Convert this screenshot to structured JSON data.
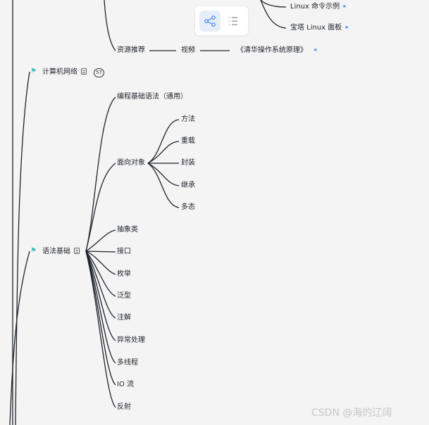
{
  "toggle": {
    "mindmap_icon": "mindmap-icon",
    "outline_icon": "outline-list-icon"
  },
  "nodes": {
    "linux_cmd": "Linux 命令示例",
    "baota": "宝塔 Linux 面板",
    "resources": "资源推荐",
    "video": "视频",
    "tsinghua": "《清华操作系统原理》",
    "network": "计算机网络",
    "network_count": "57",
    "syntax": "语法基础",
    "programming_basics": "编程基础语法（通用）",
    "oop": "面向对象",
    "method": "方法",
    "overload": "重载",
    "encapsulation": "封装",
    "inheritance": "继承",
    "polymorphism": "多态",
    "abstract_class": "抽象类",
    "interface": "接口",
    "enum": "枚举",
    "generics": "泛型",
    "annotation": "注解",
    "exception": "异常处理",
    "multithread": "多线程",
    "io": "IO 流",
    "reflection": "反射"
  },
  "colors": {
    "accent": "#4a7fe8",
    "flag": "#3cc3c0",
    "line": "#1f2329",
    "background": "#f4f4f4"
  },
  "watermark": "CSDN @海的辽阔"
}
